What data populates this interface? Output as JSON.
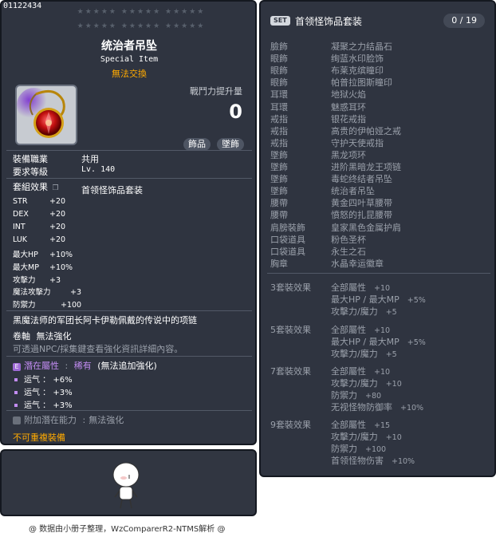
{
  "header": {
    "code": "01122434",
    "stars_row1": "★★★★★  ★★★★★  ★★★★★",
    "stars_row2": "★★★★★  ★★★★★  ★★★★★"
  },
  "item": {
    "name": "统治者吊坠",
    "type": "Special Item",
    "tradeable": "無法交換",
    "power_label": "戰鬥力提升量",
    "power_value": "0",
    "tags": [
      "飾品",
      "墜飾"
    ],
    "job_label": "裝備職業",
    "job_value": "共用",
    "level_label": "要求等級",
    "level_value": "Lv. 140",
    "set_label": "套組效果",
    "set_value": "首领怪饰品套装",
    "stats": [
      {
        "name": "STR",
        "value": "+20"
      },
      {
        "name": "DEX",
        "value": "+20"
      },
      {
        "name": "INT",
        "value": "+20"
      },
      {
        "name": "LUK",
        "value": "+20"
      },
      {
        "name": "最大HP",
        "value": "+10%"
      },
      {
        "name": "最大MP",
        "value": "+10%"
      },
      {
        "name": "攻擊力",
        "value": "+3"
      },
      {
        "name": "魔法攻擊力",
        "value": "+3"
      },
      {
        "name": "防禦力",
        "value": "+100"
      }
    ],
    "description": "黑魔法师的军团长阿卡伊勒佩戴的传说中的项链",
    "scroll_label": "卷軸",
    "scroll_value": "無法強化",
    "scroll_note": "可透過NPC/採集鍵查看強化資訊詳細內容。",
    "potential_label": "潛在屬性",
    "potential_grade": "稀有",
    "potential_note": "(無法追加強化)",
    "potential_lines": [
      "运气 ： +6%",
      "运气 ： +3%",
      "运气 ： +3%"
    ],
    "additional_label": "附加潛在能力",
    "additional_value": "無法強化",
    "no_duplicate": "不可重複裝備"
  },
  "set": {
    "badge": "SET",
    "title": "首领怪饰品套装",
    "count": "0 / 19",
    "pieces": [
      {
        "slot": "臉飾",
        "name": "凝聚之力结晶石"
      },
      {
        "slot": "眼飾",
        "name": "绚蓝水印脸饰"
      },
      {
        "slot": "眼飾",
        "name": "布莱克缤瞳印"
      },
      {
        "slot": "眼飾",
        "name": "帕普拉图斯瞳印"
      },
      {
        "slot": "耳環",
        "name": "地狱火焰"
      },
      {
        "slot": "耳環",
        "name": "魅惑耳环"
      },
      {
        "slot": "戒指",
        "name": "银花戒指"
      },
      {
        "slot": "戒指",
        "name": "高贵的伊帕娅之戒"
      },
      {
        "slot": "戒指",
        "name": "守护天使戒指"
      },
      {
        "slot": "墜飾",
        "name": "黑龙项环"
      },
      {
        "slot": "墜飾",
        "name": "进阶黑暗龙王项链"
      },
      {
        "slot": "墜飾",
        "name": "毒蛇终结者吊坠"
      },
      {
        "slot": "墜飾",
        "name": "统治者吊坠"
      },
      {
        "slot": "腰帶",
        "name": "黄金四叶草腰带"
      },
      {
        "slot": "腰帶",
        "name": "憤怒的扎昆腰带"
      },
      {
        "slot": "肩膀裝飾",
        "name": "皇家黑色金属护肩"
      },
      {
        "slot": "口袋道具",
        "name": "粉色圣杯"
      },
      {
        "slot": "口袋道具",
        "name": "永生之石"
      },
      {
        "slot": "胸章",
        "name": "水晶幸运徽章"
      }
    ],
    "effects": [
      {
        "label": "3套裝效果",
        "lines": [
          {
            "text": "全部屬性",
            "value": "+10"
          },
          {
            "text": "最大HP / 最大MP",
            "value": "+5%"
          },
          {
            "text": "攻擊力/魔力",
            "value": "+5"
          }
        ]
      },
      {
        "label": "5套裝效果",
        "lines": [
          {
            "text": "全部屬性",
            "value": "+10"
          },
          {
            "text": "最大HP / 最大MP",
            "value": "+5%"
          },
          {
            "text": "攻擊力/魔力",
            "value": "+5"
          }
        ]
      },
      {
        "label": "7套裝效果",
        "lines": [
          {
            "text": "全部屬性",
            "value": "+10"
          },
          {
            "text": "攻擊力/魔力",
            "value": "+10"
          },
          {
            "text": "防禦力",
            "value": "+80"
          },
          {
            "text": "无视怪物防御率",
            "value": "+10%"
          }
        ]
      },
      {
        "label": "9套裝效果",
        "lines": [
          {
            "text": "全部屬性",
            "value": "+15"
          },
          {
            "text": "攻擊力/魔力",
            "value": "+10"
          },
          {
            "text": "防禦力",
            "value": "+100"
          },
          {
            "text": "首领怪物伤害",
            "value": "+10%"
          }
        ]
      }
    ]
  },
  "footer": {
    "credit": "@ 数据由小册子整理，WzComparerR2-NTMS解析 @"
  }
}
